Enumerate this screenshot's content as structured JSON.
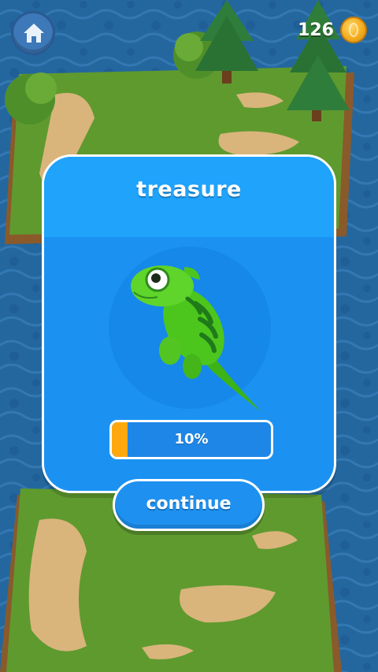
{
  "hud": {
    "coin_count": "126",
    "home_icon": "home-icon",
    "coin_icon": "coin-icon"
  },
  "modal": {
    "title": "treasure",
    "reward_icon": "green-lizard",
    "progress_label": "10%",
    "progress_fraction": 0.1,
    "continue_label": "continue"
  },
  "colors": {
    "modal_blue": "#1e9bf7",
    "progress_fill": "#ffa80e",
    "water": "#1f5f9a",
    "grass": "#5f9a2f"
  }
}
